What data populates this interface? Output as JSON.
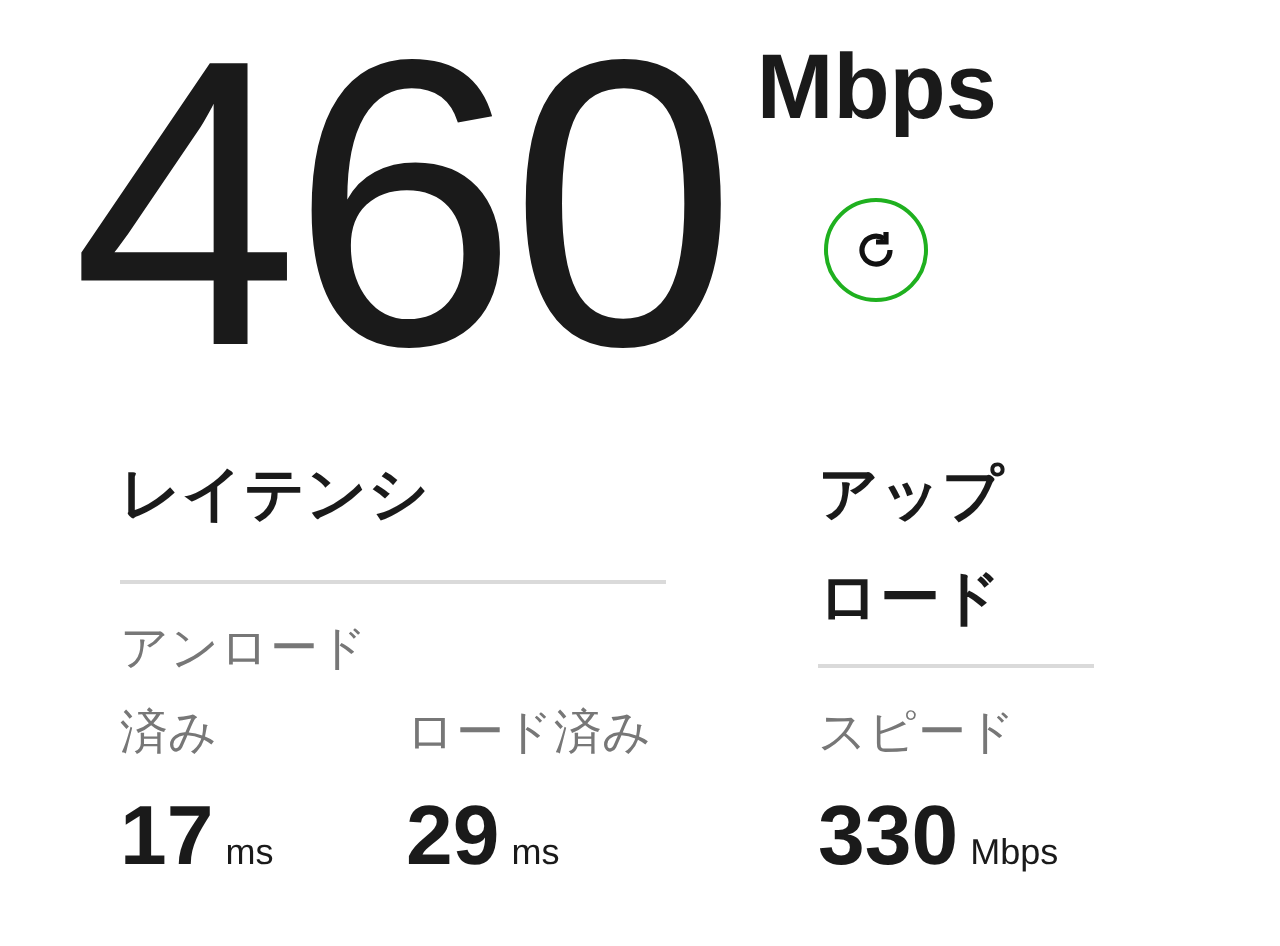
{
  "speed": {
    "value": "460",
    "unit": "Mbps"
  },
  "refresh": {
    "color": "#1fb01f"
  },
  "latency": {
    "title": "レイテンシ",
    "columns": [
      {
        "label": "アンロード済み",
        "value": "17",
        "unit": "ms"
      },
      {
        "label": "ロード済み",
        "value": "29",
        "unit": "ms"
      }
    ]
  },
  "upload": {
    "title": "アップロード",
    "label": "スピード",
    "value": "330",
    "unit": "Mbps"
  }
}
